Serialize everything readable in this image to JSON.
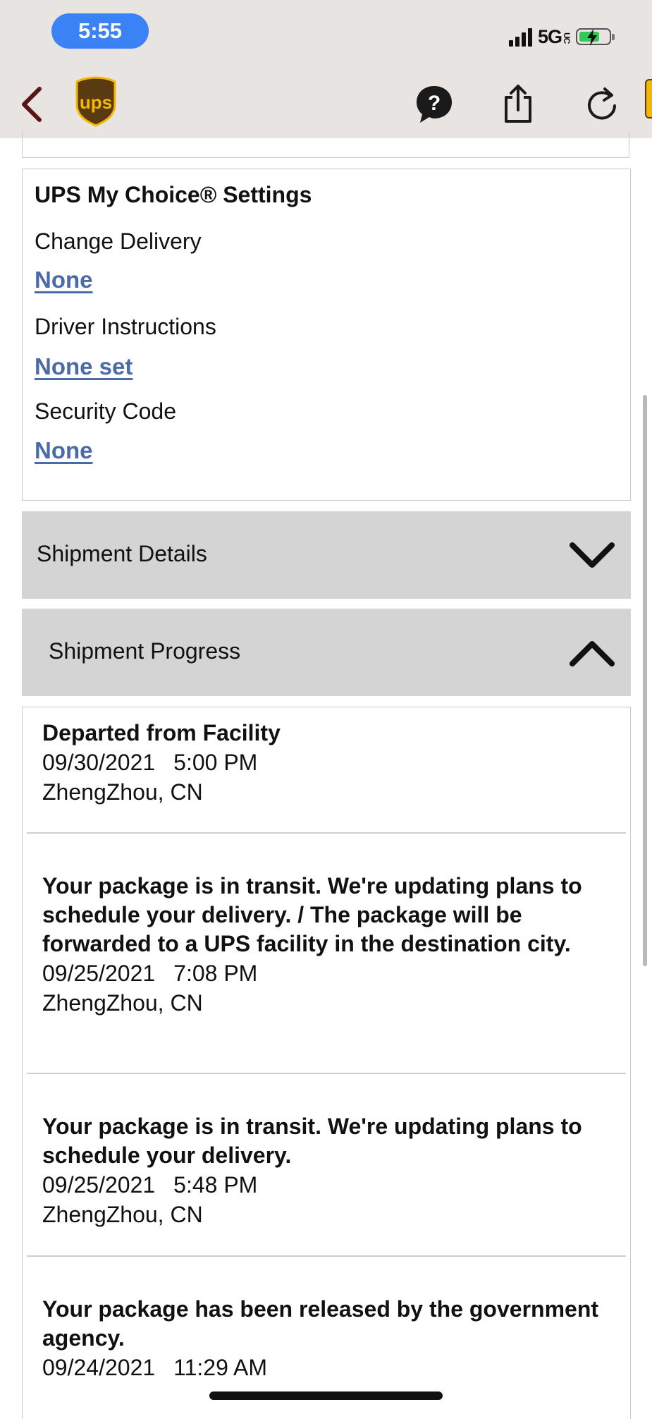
{
  "status_bar": {
    "time": "5:55",
    "network": "5G",
    "network_sup": "UC",
    "battery_state": "charging"
  },
  "header": {
    "back_icon": "chevron-left-icon",
    "logo_text": "ups",
    "help_icon": "question-bubble-icon",
    "share_icon": "share-icon",
    "reload_icon": "reload-icon"
  },
  "my_choice": {
    "title": "UPS My Choice® Settings",
    "change_delivery_label": "Change Delivery",
    "change_delivery_value": "None",
    "driver_instructions_label": "Driver Instructions",
    "driver_instructions_value": "None set",
    "security_code_label": "Security Code",
    "security_code_value": "None"
  },
  "shipment_details": {
    "label": "Shipment Details",
    "state": "collapsed"
  },
  "shipment_progress": {
    "label": "Shipment Progress",
    "state": "expanded",
    "events": [
      {
        "description": "Departed from Facility",
        "date": "09/30/2021",
        "time": "5:00 PM",
        "location": "ZhengZhou, CN"
      },
      {
        "description": "Your package is in transit. We're updating plans to schedule your delivery. / The package will be forwarded to a UPS facility in the destination city.",
        "date": "09/25/2021",
        "time": "7:08 PM",
        "location": "ZhengZhou, CN"
      },
      {
        "description": "Your package is in transit. We're updating plans to schedule your delivery.",
        "date": "09/25/2021",
        "time": "5:48 PM",
        "location": "ZhengZhou, CN"
      },
      {
        "description": "Your package has been released by the government agency.",
        "date": "09/24/2021",
        "time": "11:29 AM",
        "location": ""
      }
    ]
  },
  "colors": {
    "link": "#4a6aa8",
    "header_bg": "#e7e4e1",
    "accordion_bg": "#d4d4d4",
    "time_pill": "#3b82f6",
    "ups_brown": "#5a3a10",
    "ups_gold": "#f5b800"
  }
}
